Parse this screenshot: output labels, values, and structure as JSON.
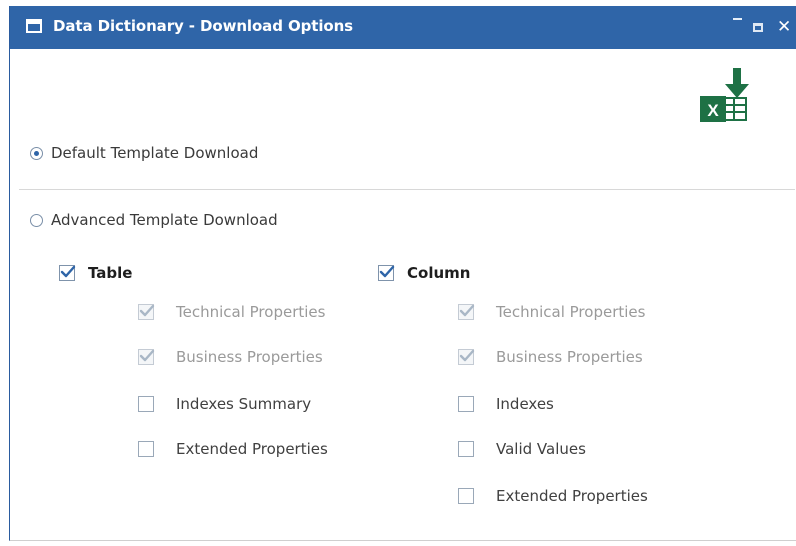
{
  "window": {
    "title": "Data Dictionary - Download Options"
  },
  "export": {
    "icon": "excel-download-icon",
    "letter": "X"
  },
  "options": {
    "default_label": "Default Template Download",
    "default_selected": true,
    "advanced_label": "Advanced Template Download",
    "advanced_selected": false
  },
  "table": {
    "label": "Table",
    "checked": true,
    "items": [
      {
        "label": "Technical Properties",
        "checked": true,
        "disabled": true
      },
      {
        "label": "Business Properties",
        "checked": true,
        "disabled": true
      },
      {
        "label": "Indexes Summary",
        "checked": false,
        "disabled": false
      },
      {
        "label": "Extended Properties",
        "checked": false,
        "disabled": false
      }
    ]
  },
  "column": {
    "label": "Column",
    "checked": true,
    "items": [
      {
        "label": "Technical Properties",
        "checked": true,
        "disabled": true
      },
      {
        "label": "Business Properties",
        "checked": true,
        "disabled": true
      },
      {
        "label": "Indexes",
        "checked": false,
        "disabled": false
      },
      {
        "label": "Valid Values",
        "checked": false,
        "disabled": false
      },
      {
        "label": "Extended Properties",
        "checked": false,
        "disabled": false
      }
    ]
  },
  "colors": {
    "titlebar": "#2f65a8",
    "excel_green": "#1e7145",
    "check_active": "#2f65a8",
    "check_disabled": "#a9b7c6"
  }
}
